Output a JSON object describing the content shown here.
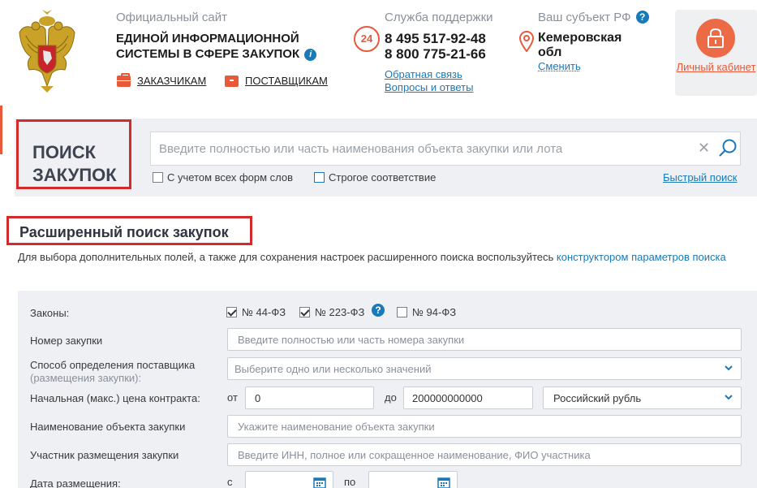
{
  "header": {
    "site_caption": "Официальный сайт",
    "site_title_line1": "ЕДИНОЙ ИНФОРМАЦИОННОЙ",
    "site_title_line2": "СИСТЕМЫ В СФЕРЕ ЗАКУПОК",
    "info_icon": "i",
    "customers_link": "ЗАКАЗЧИКАМ",
    "suppliers_link": "ПОСТАВЩИКАМ",
    "support_caption": "Служба поддержки",
    "support_badge": "24",
    "phone1": "8 495 517-92-48",
    "phone2": "8 800 775-21-66",
    "feedback_link": "Обратная связь",
    "faq_link": "Вопросы и ответы",
    "region_caption": "Ваш субъект РФ",
    "help_icon": "?",
    "region_name": "Кемеровская обл",
    "region_change": "Сменить",
    "cabinet_label": "Личный кабинет"
  },
  "search": {
    "title_line1": "ПОИСК",
    "title_line2": "ЗАКУПОК",
    "placeholder": "Введите полностью или часть наименования объекта закупки или лота",
    "clear_icon": "✕",
    "option_all_forms": "С учетом всех форм слов",
    "option_strict": "Строгое соответствие",
    "quick_search": "Быстрый поиск"
  },
  "advanced": {
    "title": "Расширенный поиск закупок",
    "note_text": "Для выбора дополнительных полей, а также для сохранения настроек расширенного поиска воспользуйтесь ",
    "note_link": "конструктором параметров поиска",
    "laws_label": "Законы:",
    "laws": [
      {
        "label": "№ 44-ФЗ",
        "checked": true
      },
      {
        "label": "№ 223-ФЗ",
        "checked": true
      },
      {
        "label": "№ 94-ФЗ",
        "checked": false
      }
    ],
    "purchase_number_label": "Номер закупки",
    "purchase_number_placeholder": "Введите полностью или часть номера закупки",
    "method_label": "Способ определения поставщика",
    "method_sublabel": "(размещения закупки):",
    "method_placeholder": "Выберите одно или несколько значений",
    "price_label": "Начальная (макс.) цена контракта:",
    "price_from_label": "от",
    "price_from_value": "0",
    "price_to_label": "до",
    "price_to_value": "200000000000",
    "currency": "Российский рубль",
    "object_name_label": "Наименование объекта закупки",
    "object_name_placeholder": "Укажите наименование объекта закупки",
    "participant_label": "Участник размещения закупки",
    "participant_placeholder": "Введите ИНН, полное или сокращенное наименование, ФИО участника",
    "date_label": "Дата размещения:",
    "date_from_label": "с",
    "date_to_label": "по"
  },
  "colors": {
    "accent": "#e8593a",
    "link": "#1a79b8",
    "highlight_frame": "#d32b2b",
    "panel_bg": "#eef0f3"
  }
}
